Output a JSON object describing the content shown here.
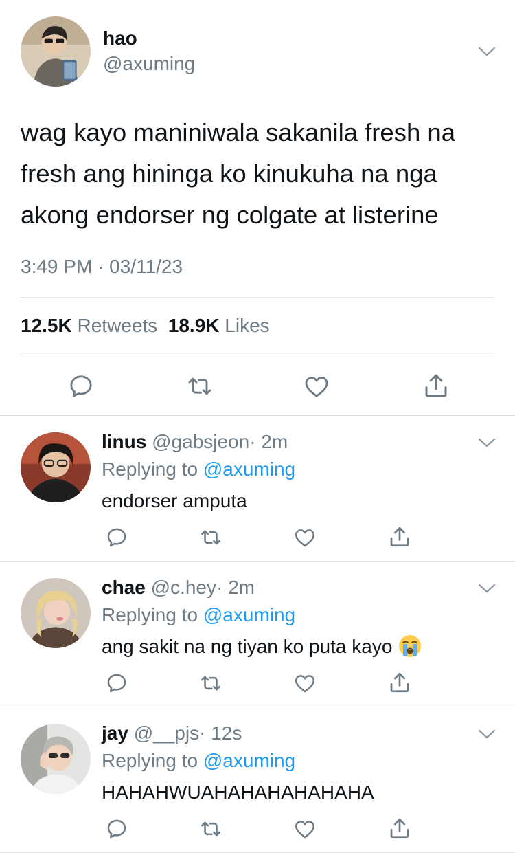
{
  "tweet": {
    "name": "hao",
    "handle": "@axuming",
    "text": "wag kayo maniniwala sakanila fresh na fresh ang hininga ko kinukuha na nga akong endorser ng colgate at listerine",
    "timestamp": "3:49 PM · 03/11/23",
    "retweets_count": "12.5K",
    "retweets_label": "Retweets",
    "likes_count": "18.9K",
    "likes_label": "Likes"
  },
  "replies": [
    {
      "name": "linus",
      "handle": "@gabsjeon",
      "time": "· 2m",
      "replying_prefix": "Replying to",
      "replying_to": "@axuming",
      "text": "endorser amputa"
    },
    {
      "name": "chae",
      "handle": "@c.hey",
      "time": "· 2m",
      "replying_prefix": "Replying to",
      "replying_to": "@axuming",
      "text": "ang sakit na ng tiyan ko puta kayo",
      "emoji": "loudly-crying-face"
    },
    {
      "name": "jay",
      "handle": "@__pjs",
      "time": "· 12s",
      "replying_prefix": "Replying to",
      "replying_to": "@axuming",
      "text": "HAHAHWUAHAHAHAHAHAHA"
    }
  ],
  "icons": [
    "comment-icon",
    "retweet-icon",
    "like-icon",
    "share-icon",
    "chevron-down-icon"
  ],
  "colors": {
    "icon": "#6e7b85",
    "mention": "#1d9bf0",
    "text": "#0f1419",
    "divider": "#e1e5e8"
  }
}
